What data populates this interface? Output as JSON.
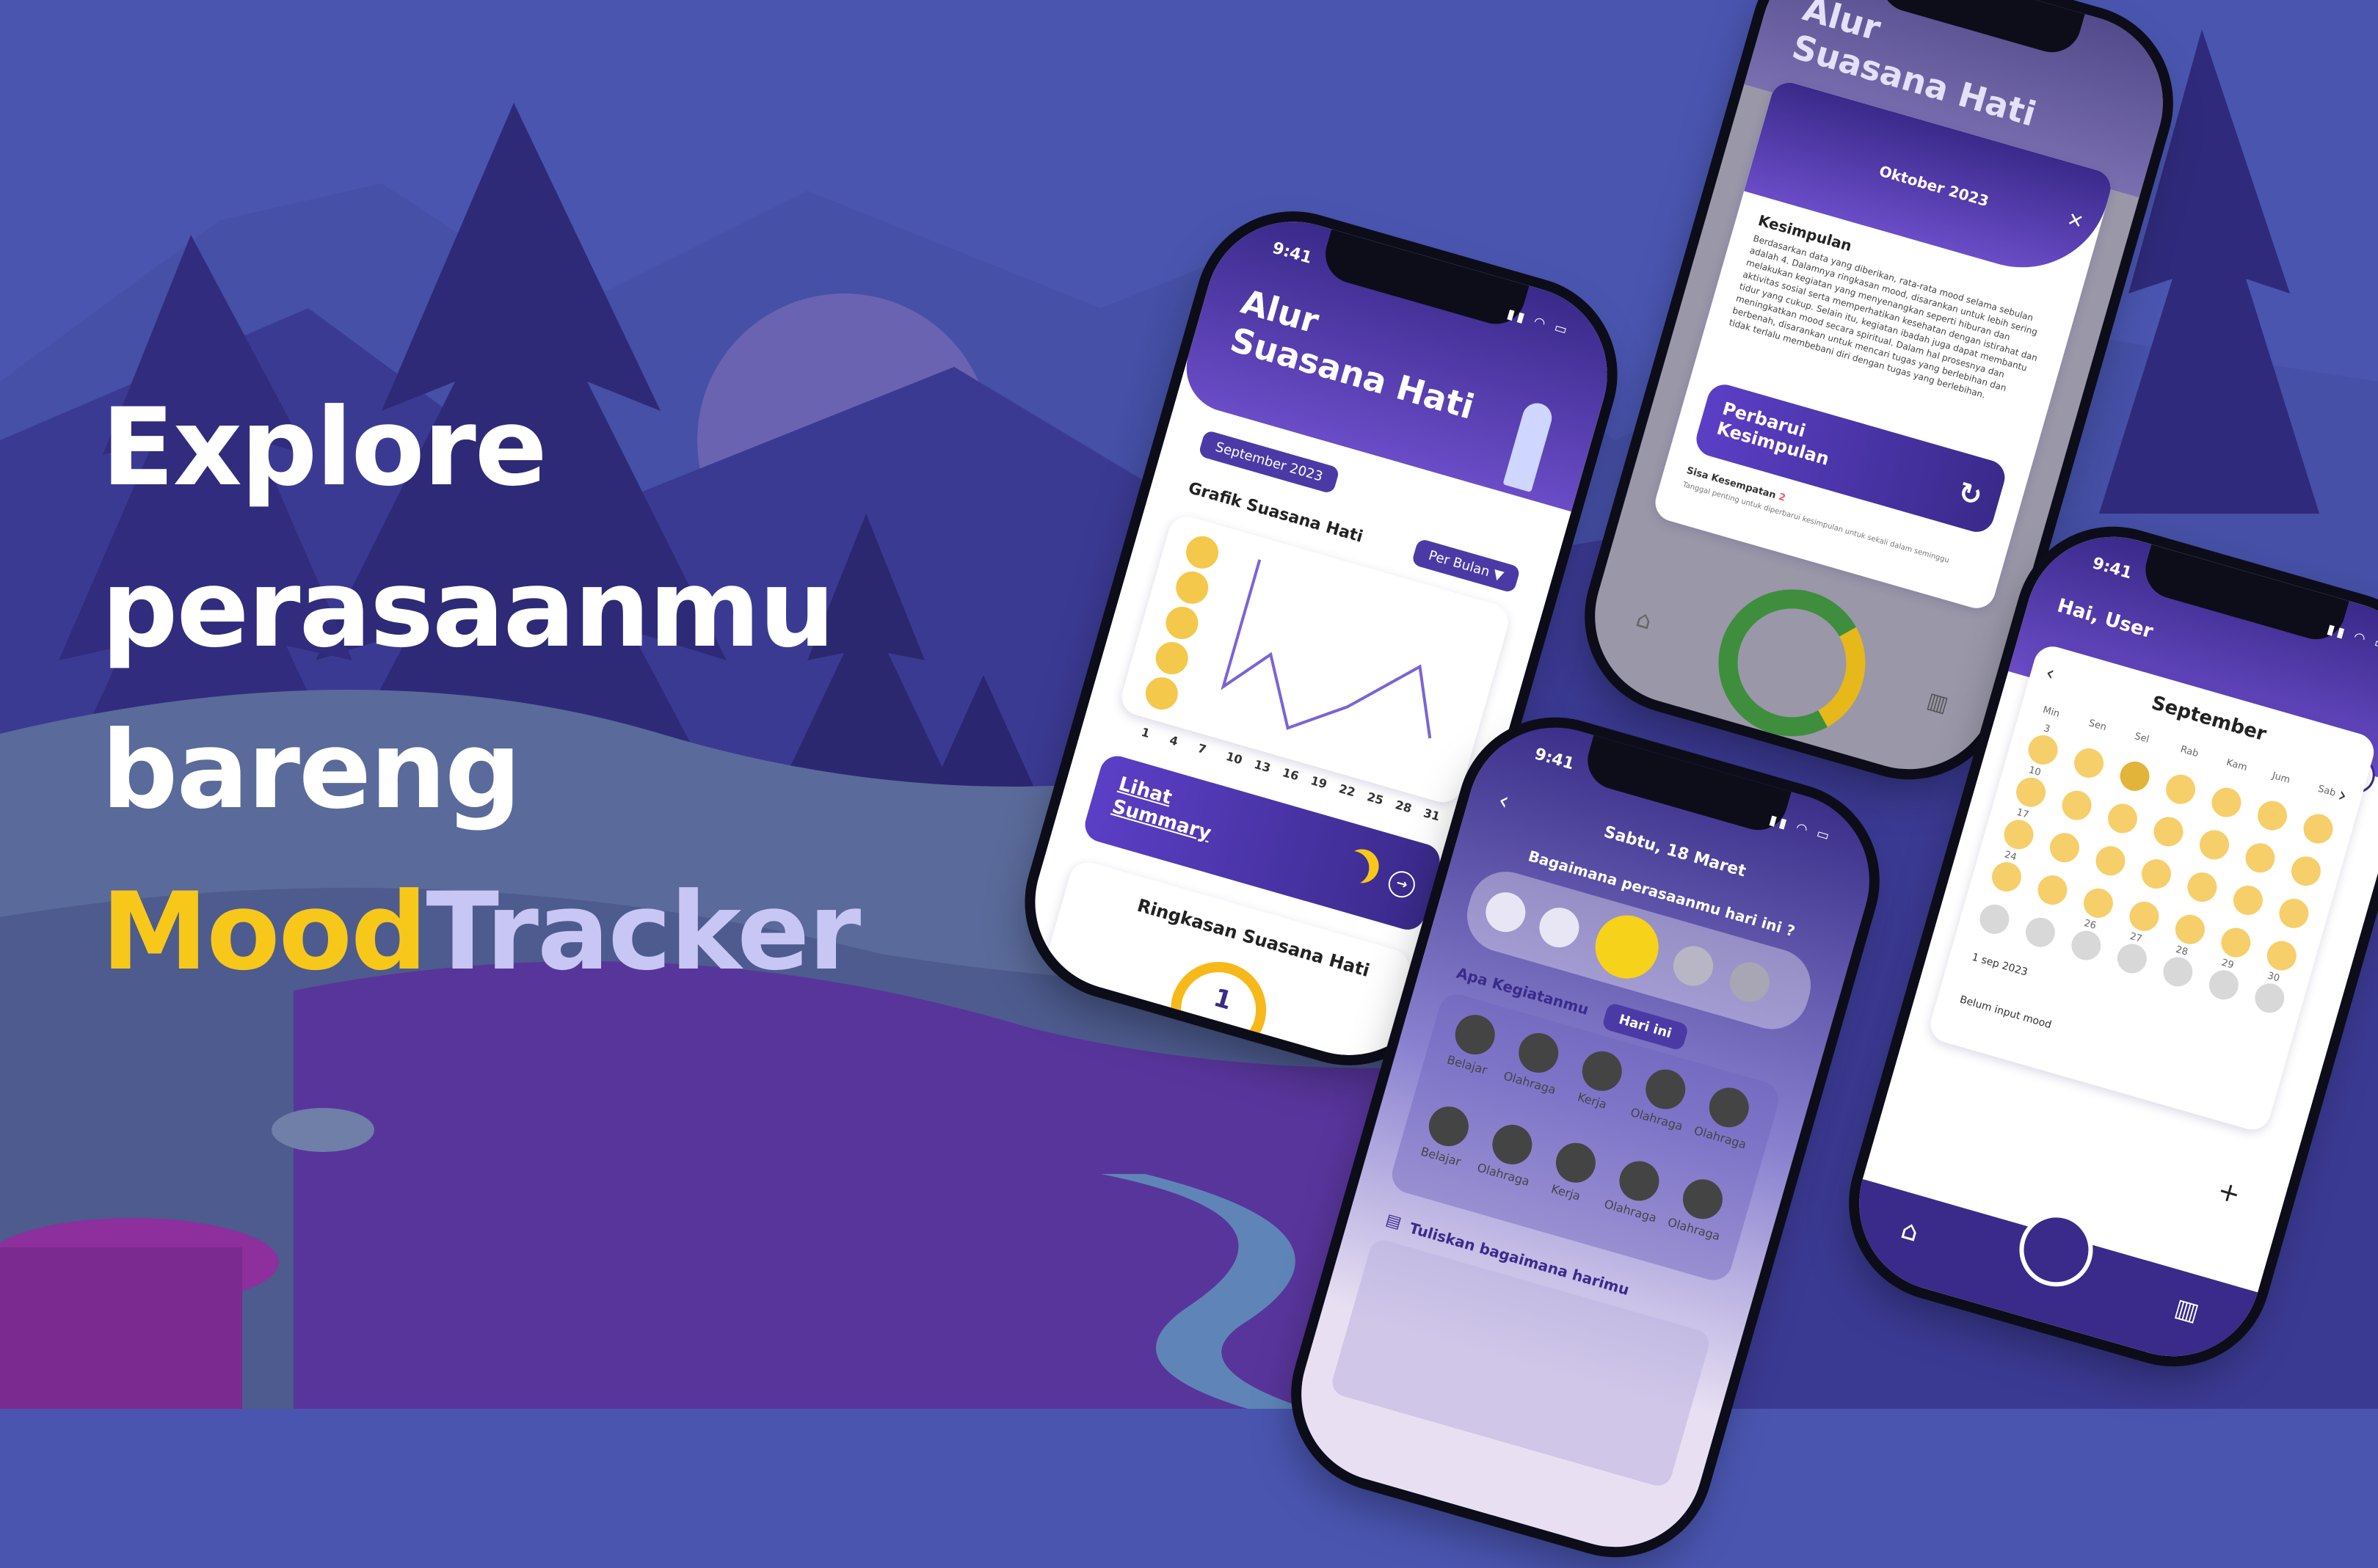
{
  "colors": {
    "accent_yellow": "#f7c81a",
    "accent_lavender": "#c8c6f4",
    "primary_purple": "#4b3aa6",
    "background": "#4a55b0"
  },
  "headline": {
    "line1": "Explore",
    "line2": "perasaanmu",
    "line3": "bareng",
    "brand_part1": "Mood",
    "brand_part2": "Tracker"
  },
  "phone1": {
    "time": "9:41",
    "title_line1": "Alur",
    "title_line2": "Suasana Hati",
    "month_chip": "September 2023",
    "chart_label": "Grafik Suasana Hati",
    "period_dropdown": "Per Bulan",
    "x_ticks": [
      "1",
      "4",
      "7",
      "10",
      "13",
      "16",
      "19",
      "22",
      "25",
      "28",
      "31"
    ],
    "summary_button_line1": "Lihat",
    "summary_button_line2": "Summary",
    "summary_title": "Ringkasan Suasana Hati",
    "summary_count": "1",
    "badges": [
      "0",
      "0",
      "1",
      "0",
      "0"
    ]
  },
  "phone2": {
    "title_line1": "Alur",
    "title_line2": "Suasana Hati",
    "modal_month": "Oktober 2023",
    "conclusion_title": "Kesimpulan",
    "conclusion_text": "Berdasarkan data yang diberikan, rata-rata mood selama sebulan adalah 4. Dalamnya ringkasan mood, disarankan untuk lebih sering melakukan kegiatan yang menyenangkan seperti hiburan dan aktivitas sosial serta memperhatikan kesehatan dengan istirahat dan tidur yang cukup. Selain itu, kegiatan ibadah juga dapat membantu meningkatkan mood secara spiritual. Dalam hal prosesnya dan berbenah, disarankan untuk mencari tugas yang berlebihan dan tidak terlalu membebani diri dengan tugas yang berlebihan.",
    "refresh_line1": "Perbarui",
    "refresh_line2": "Kesimpulan",
    "remaining_label": "Sisa Kesempatan",
    "remaining_value": "2",
    "remaining_note": "Tanggal penting untuk diperbarui kesimpulan untuk sekali dalam seminggu"
  },
  "phone3": {
    "time": "9:41",
    "date": "Sabtu, 18 Maret",
    "question": "Bagaimana perasaanmu hari ini ?",
    "activity_label": "Apa Kegiatanmu",
    "activity_chip": "Hari ini",
    "activities_row1": [
      "Belajar",
      "Olahraga",
      "Kerja",
      "Olahraga",
      "Olahraga"
    ],
    "activities_row2": [
      "Belajar",
      "Olahraga",
      "Kerja",
      "Olahraga",
      "Olahraga"
    ],
    "journal_label": "Tuliskan bagaimana harimu"
  },
  "phone4": {
    "time": "9:41",
    "greeting": "Hai, User",
    "month": "September",
    "weekdays": [
      "Min",
      "Sen",
      "Sel",
      "Rab",
      "Kam",
      "Jum",
      "Sab"
    ],
    "visible_dates": [
      "3",
      "10",
      "17",
      "24",
      "26",
      "27",
      "28",
      "29",
      "30"
    ],
    "selected_date": "1 sep 2023",
    "entry_status": "Belum input mood",
    "add_symbol": "+"
  }
}
